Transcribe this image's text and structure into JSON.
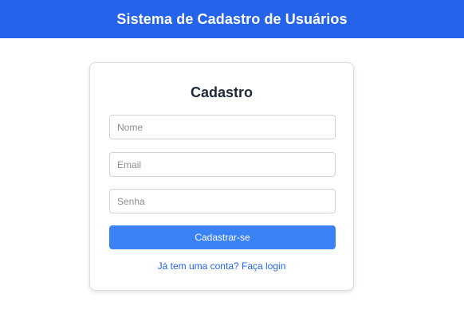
{
  "header": {
    "title": "Sistema de Cadastro de Usuários"
  },
  "form": {
    "title": "Cadastro",
    "name_placeholder": "Nome",
    "email_placeholder": "Email",
    "password_placeholder": "Senha",
    "submit_label": "Cadastrar-se",
    "login_link": "Já tem uma conta? Faça login"
  },
  "colors": {
    "header_bg": "#2563eb",
    "button_bg": "#3b82f6",
    "link": "#2563eb"
  }
}
